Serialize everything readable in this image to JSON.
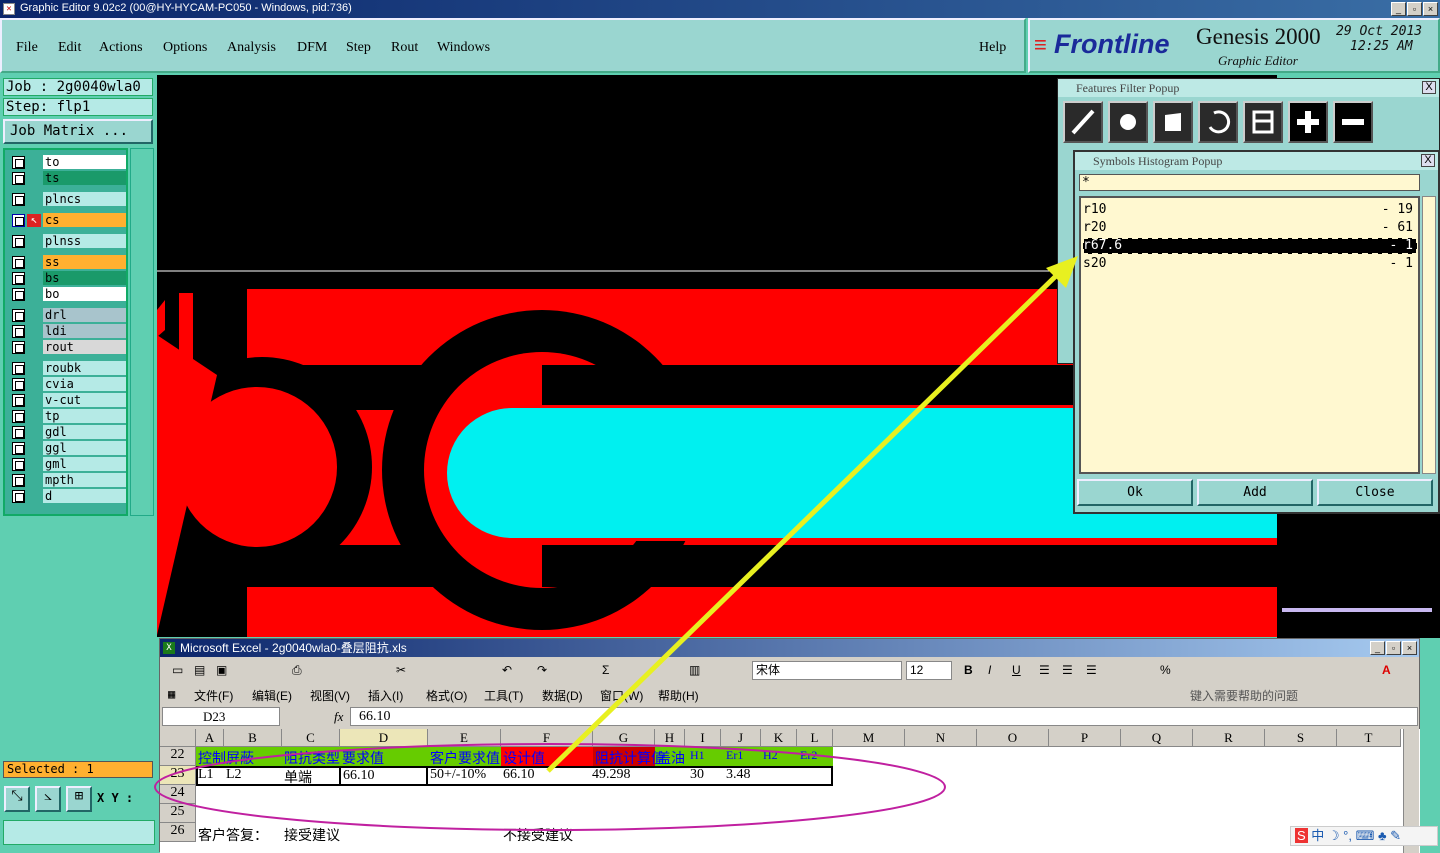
{
  "titlebar": {
    "title": "Graphic Editor 9.02c2 (00@HY-HYCAM-PC050 - Windows, pid:736)",
    "min": "_",
    "max": "▫",
    "close": "×"
  },
  "menu": [
    "File",
    "Edit",
    "Actions",
    "Options",
    "Analysis",
    "DFM",
    "Step",
    "Rout",
    "Windows"
  ],
  "help": "Help",
  "brand": {
    "name": "Frontline",
    "product": "Genesis 2000",
    "sub": "Graphic Editor",
    "date": "29 Oct 2013",
    "time": "12:25 AM"
  },
  "job": {
    "job": "Job : 2g0040wla0",
    "step": "Step: flp1",
    "matrix": "Job Matrix ..."
  },
  "layers": [
    {
      "name": "to",
      "bg": "#ffffff"
    },
    {
      "name": "ts",
      "bg": "#1a9a6a"
    },
    {
      "name": "plncs",
      "bg": "#b5eae6"
    },
    {
      "name": "cs",
      "bg": "#ffb030"
    },
    {
      "name": "plnss",
      "bg": "#b5eae6"
    },
    {
      "name": "ss",
      "bg": "#ffb030"
    },
    {
      "name": "bs",
      "bg": "#1a9a6a"
    },
    {
      "name": "bo",
      "bg": "#ffffff"
    },
    {
      "name": "drl",
      "bg": "#a8c4cc"
    },
    {
      "name": "ldi",
      "bg": "#a8c4cc"
    },
    {
      "name": "rout",
      "bg": "#d8d8d8"
    },
    {
      "name": "roubk",
      "bg": "#b5eae6"
    },
    {
      "name": "cvia",
      "bg": "#b5eae6"
    },
    {
      "name": "v-cut",
      "bg": "#b5eae6"
    },
    {
      "name": "tp",
      "bg": "#b5eae6"
    },
    {
      "name": "gdl",
      "bg": "#b5eae6"
    },
    {
      "name": "ggl",
      "bg": "#b5eae6"
    },
    {
      "name": "gml",
      "bg": "#b5eae6"
    },
    {
      "name": "mpth",
      "bg": "#b5eae6"
    },
    {
      "name": "d",
      "bg": "#b5eae6"
    }
  ],
  "selected": "Selected : 1",
  "xy": "X Y :",
  "ffp": {
    "title": "Features Filter Popup",
    "close": "X"
  },
  "sh": {
    "title": "Symbols Histogram Popup",
    "close": "X",
    "filter": "*",
    "items": [
      {
        "sym": "r10",
        "count": "- 19"
      },
      {
        "sym": "r20",
        "count": "- 61"
      },
      {
        "sym": "r67.6",
        "count": "- 1"
      },
      {
        "sym": "s20",
        "count": "- 1"
      }
    ],
    "ok": "Ok",
    "add": "Add",
    "closeBtn": "Close"
  },
  "excel": {
    "title": "Microsoft Excel - 2g0040wla0-叠层阻抗.xls",
    "menu": [
      "文件(F)",
      "编辑(E)",
      "视图(V)",
      "插入(I)",
      "格式(O)",
      "工具(T)",
      "数据(D)",
      "窗口(W)",
      "帮助(H)"
    ],
    "help_placeholder": "键入需要帮助的问题",
    "font": "宋体",
    "size": "12",
    "namebox": "D23",
    "formula": "66.10",
    "cols": [
      "A",
      "B",
      "C",
      "D",
      "E",
      "F",
      "G",
      "H",
      "I",
      "J",
      "K",
      "L",
      "M",
      "N",
      "O",
      "P",
      "Q",
      "R",
      "S",
      "T"
    ],
    "rows": [
      "22",
      "23",
      "24",
      "25",
      "26"
    ],
    "r22": [
      "控制",
      "屏蔽",
      "阻抗类型",
      "要求值",
      "客户要求值",
      "设计值",
      "阻抗计算值",
      "盖油",
      "H1",
      "Er1",
      "H2",
      "Er2"
    ],
    "r23": [
      "L1",
      "L2",
      "单端",
      "66.10",
      "50+/-10%",
      "66.10",
      "49.298",
      "30",
      "3.48"
    ],
    "r26": [
      "客户答复：",
      "接受建议",
      "不接受建议"
    ]
  }
}
